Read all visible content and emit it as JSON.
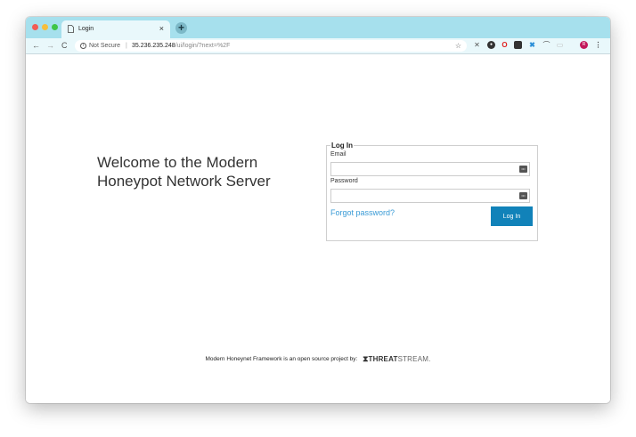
{
  "browser": {
    "tab_title": "Login",
    "tab_close_glyph": "×",
    "new_tab_glyph": "+",
    "security_label": "Not Secure",
    "separator": "|",
    "url_host": "35.236.235.248",
    "url_path": "/ui/login/?next=%2F",
    "nav_glyphs": {
      "back": "←",
      "forward": "→",
      "reload": "C"
    },
    "info_glyph": "i",
    "star_glyph": "☆",
    "menu_glyph": "⋮",
    "profile_initial": "R",
    "icons": [
      "page-icon",
      "info-icon",
      "star-icon",
      "extension-icons",
      "profile-avatar",
      "menu-icon"
    ]
  },
  "page": {
    "welcome_line1": "Welcome to the Modern",
    "welcome_line2": "Honeypot Network Server",
    "login": {
      "legend": "Log In",
      "email_label": "Email",
      "password_label": "Password",
      "email_value": "",
      "password_value": "",
      "forgot_link": "Forgot password?",
      "submit_label": "Log In"
    },
    "footer": {
      "text": "Modern Honeynet Framework is an open source project by:",
      "logo_mark": "⧗",
      "logo_bold": "THREAT",
      "logo_light": "STREAM."
    }
  },
  "colors": {
    "tabstrip": "#a6e0ed",
    "toolbar": "#e9f8fb",
    "primary_button": "#1182b9",
    "link": "#3a9bd6"
  }
}
